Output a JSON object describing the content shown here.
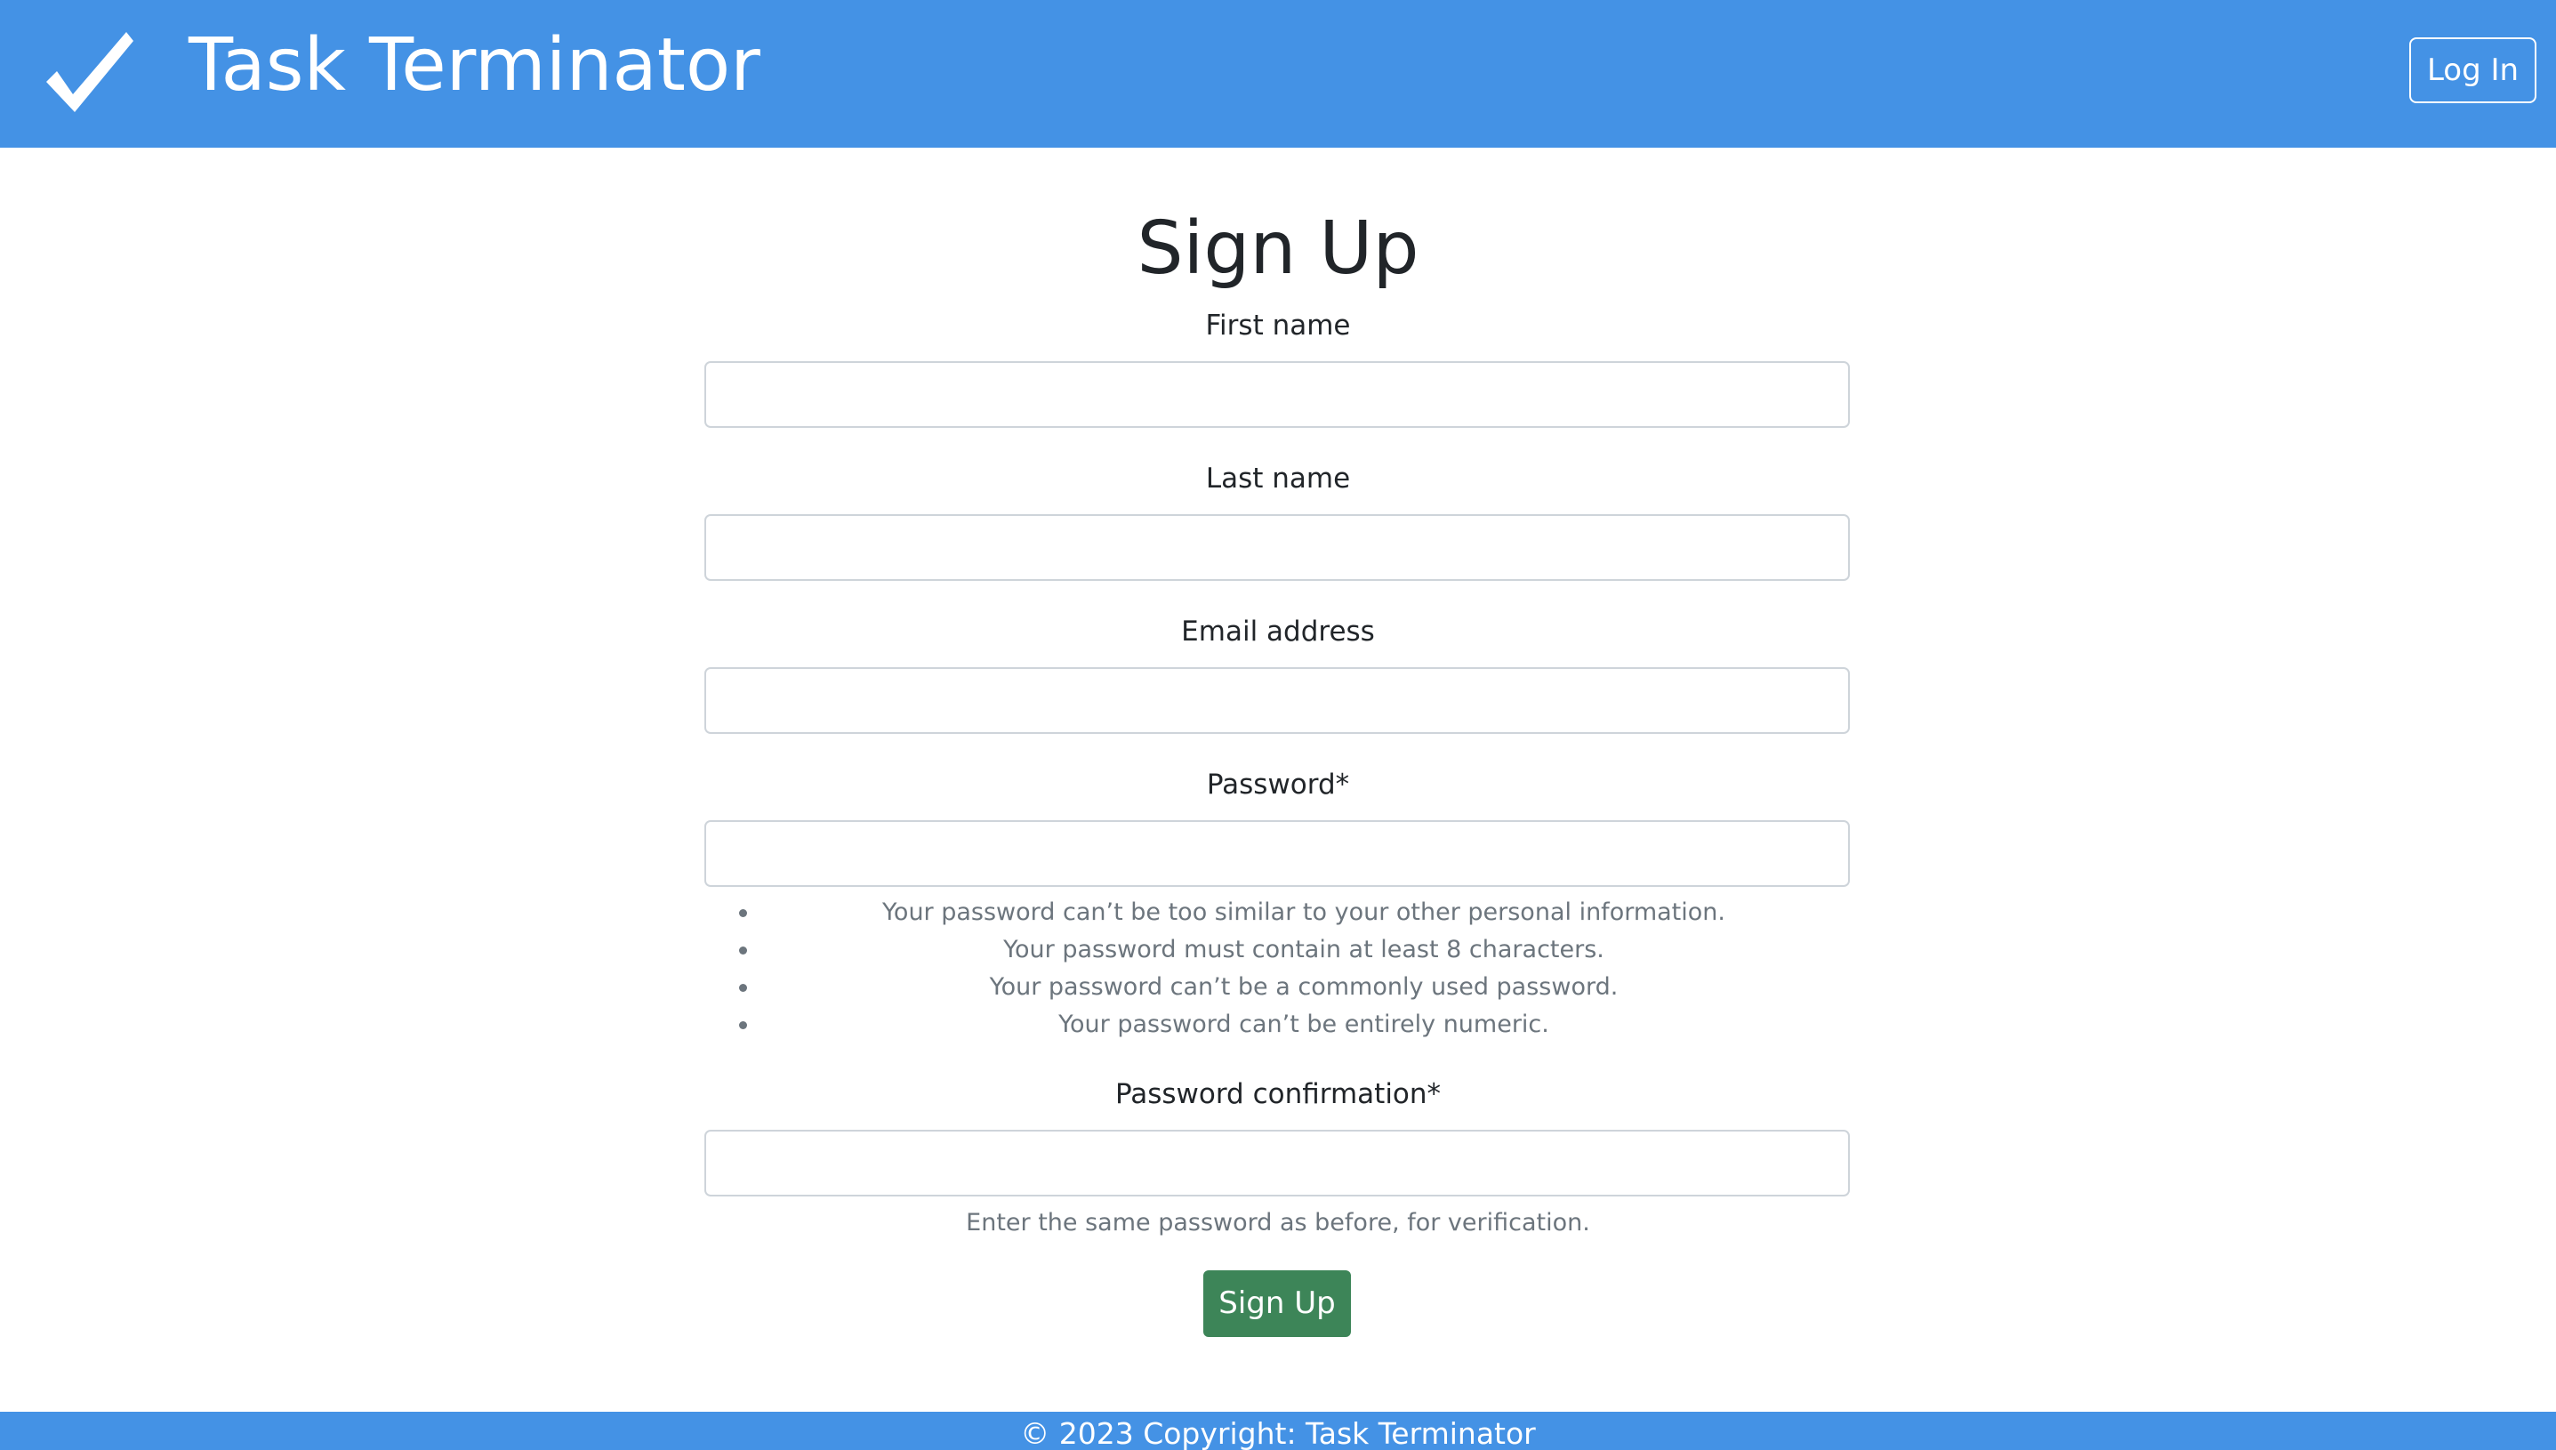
{
  "header": {
    "brand_icon": "checkmark-icon",
    "brand_title": "Task Terminator",
    "login_label": "Log In",
    "background_color": "#4492e5"
  },
  "form": {
    "title": "Sign Up",
    "fields": [
      {
        "label": "First name",
        "value": "",
        "placeholder": ""
      },
      {
        "label": "Last name",
        "value": "",
        "placeholder": ""
      },
      {
        "label": "Email address",
        "value": "",
        "placeholder": ""
      },
      {
        "label": "Password*",
        "value": "",
        "placeholder": ""
      },
      {
        "label": "Password confirmation*",
        "value": "",
        "placeholder": ""
      }
    ],
    "password_help": [
      "Your password can’t be too similar to your other personal information.",
      "Your password must contain at least 8 characters.",
      "Your password can’t be a commonly used password.",
      "Your password can’t be entirely numeric."
    ],
    "confirmation_help": "Enter the same password as before, for verification.",
    "submit_label": "Sign Up",
    "submit_color": "#3d8558"
  },
  "footer": {
    "text": "© 2023 Copyright: Task Terminator"
  }
}
